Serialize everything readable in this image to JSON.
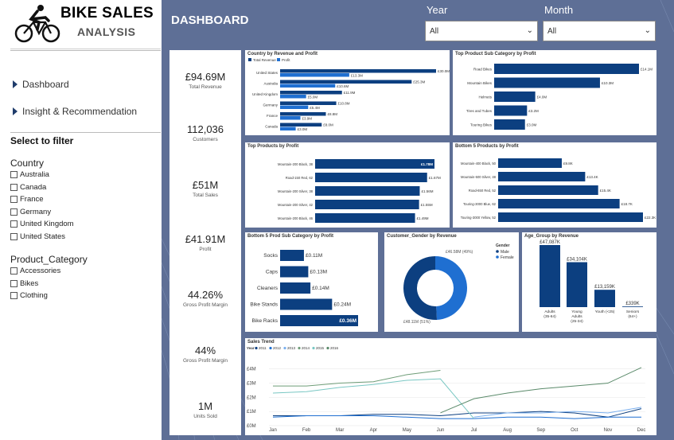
{
  "logo": {
    "title": "BIKE SALES",
    "subtitle": "ANALYSIS",
    "icon": "cyclist-icon"
  },
  "nav": [
    {
      "label": "Dashboard",
      "icon": "chevron-right-icon"
    },
    {
      "label": "Insight & Recommendation",
      "icon": "chevron-right-icon"
    }
  ],
  "filters": {
    "heading": "Select to filter",
    "country": {
      "title": "Country",
      "options": [
        "Australia",
        "Canada",
        "France",
        "Germany",
        "United Kingdom",
        "United States"
      ]
    },
    "category": {
      "title": "Product_Category",
      "options": [
        "Accessories",
        "Bikes",
        "Clothing"
      ]
    }
  },
  "header": {
    "title": "DASHBOARD"
  },
  "slicers": {
    "year": {
      "label": "Year",
      "value": "All"
    },
    "month": {
      "label": "Month",
      "value": "All"
    }
  },
  "kpis": [
    {
      "value": "£94.69M",
      "label": "Total Revenue"
    },
    {
      "value": "112,036",
      "label": "Customers"
    },
    {
      "value": "£51M",
      "label": "Total Sales"
    },
    {
      "value": "£41.91M",
      "label": "Profit"
    },
    {
      "value": "44.26%",
      "label": "Gross Profit Margin"
    },
    {
      "value": "44%",
      "label": "Gross Profit Margin"
    },
    {
      "value": "1M",
      "label": "Units Sold"
    }
  ],
  "colors": {
    "dark": "#0c3f80",
    "mid": "#1f6fd1",
    "light": "#7bb0ef",
    "accent": "#5e6f96"
  },
  "chart_data": [
    {
      "id": "country",
      "type": "bar",
      "title": "Country by Revenue and Profit",
      "legend": [
        "Total Revenue",
        "Profit"
      ],
      "categories": [
        "United States",
        "Australia",
        "United Kingdom",
        "Germany",
        "France",
        "Canada"
      ],
      "series": [
        {
          "name": "Total Revenue",
          "values": [
            30.0,
            25.3,
            11.9,
            10.8,
            8.8,
            8.0
          ],
          "labels": [
            "£30.0M",
            "£25.3M",
            "£11.9M",
            "£10.8M",
            "£8.8M",
            "£8.0M"
          ]
        },
        {
          "name": "Profit",
          "values": [
            13.3,
            10.6,
            5.0,
            5.4,
            3.9,
            3.0
          ],
          "labels": [
            "£13.3M",
            "£10.6M",
            "£5.0M",
            "£5.4M",
            "£3.9M",
            "£3.0M"
          ]
        }
      ]
    },
    {
      "id": "topsub",
      "type": "bar",
      "title": "Top Product Sub Category by Profit",
      "categories": [
        "Road Bikes",
        "Mountain Bikes",
        "Helmets",
        "Tires and Tubes",
        "Touring Bikes"
      ],
      "values": [
        14.1,
        10.3,
        4.0,
        3.2,
        3.0
      ],
      "labels": [
        "£14.1M",
        "£10.3M",
        "£4.0M",
        "£3.2M",
        "£3.0M"
      ]
    },
    {
      "id": "topprod",
      "type": "bar",
      "title": "Top Products by Profit",
      "categories": [
        "Mountain-200 Black, 38",
        "Road-150 Red, 62",
        "Mountain-200 Silver, 38",
        "Mountain-200 Silver, 42",
        "Mountain-200 Black, 46"
      ],
      "values": [
        1.78,
        1.67,
        1.56,
        1.55,
        1.49
      ],
      "labels": [
        "£1.78M",
        "£1.67M",
        "£1.56M",
        "£1.55M",
        "£1.49M"
      ]
    },
    {
      "id": "bottomprod",
      "type": "bar",
      "title": "Bottom 5 Products by Profit",
      "categories": [
        "Mountain-400 Black, 50",
        "Mountain-500 Silver, 48",
        "Road-650 Red, 52",
        "Touring-3000 Blue, 62",
        "Touring-3000 Yellow, 52"
      ],
      "values": [
        9.8,
        13.4,
        15.4,
        18.7,
        22.3
      ],
      "labels": [
        "£9.8K",
        "£13.4K",
        "£15.4K",
        "£18.7K",
        "£22.3K"
      ]
    },
    {
      "id": "bottomsub",
      "type": "bar",
      "title": "Bottom 5 Prod Sub Category by Profit",
      "categories": [
        "Socks",
        "Caps",
        "Cleaners",
        "Bike Stands",
        "Bike Racks"
      ],
      "values": [
        0.11,
        0.13,
        0.14,
        0.24,
        0.36
      ],
      "labels": [
        "£0.11M",
        "£0.13M",
        "£0.14M",
        "£0.24M",
        "£0.36M"
      ]
    },
    {
      "id": "gender",
      "type": "pie",
      "title": "Customer_Gender by Revenue",
      "legend_title": "Gender",
      "categories": [
        "Male",
        "Female"
      ],
      "values": [
        48.11,
        46.58
      ],
      "labels": [
        "£48.11M (51%)",
        "£46.58M (49%)"
      ]
    },
    {
      "id": "age",
      "type": "bar",
      "title": "Age_Group by Revenue",
      "categories": [
        "Adults (35-64)",
        "Young Adults (25-34)",
        "Youth (<25)",
        "Seniors (64+)"
      ],
      "category_lines": [
        [
          "Adults",
          "(35-64)"
        ],
        [
          "Young",
          "Adults",
          "(25-34)"
        ],
        [
          "Youth (<25)"
        ],
        [
          "Seniors",
          "(64+)"
        ]
      ],
      "values": [
        47.087,
        34.104,
        13.159,
        0.339
      ],
      "labels": [
        "£47,087K",
        "£34,104K",
        "£13,159K",
        "£339K"
      ]
    },
    {
      "id": "trend",
      "type": "line",
      "title": "Sales Trend",
      "legend_title": "Year",
      "x": [
        "Jan",
        "Feb",
        "Mar",
        "Apr",
        "May",
        "Jun",
        "Jul",
        "Aug",
        "Sep",
        "Oct",
        "Nov",
        "Dec"
      ],
      "yticks": [
        "£0M",
        "£1M",
        "£2M",
        "£3M",
        "£4M"
      ],
      "ylim": [
        0,
        4.6
      ],
      "series": [
        {
          "name": "2011",
          "color": "#0c3f80",
          "values": [
            0.7,
            0.7,
            0.7,
            0.8,
            0.8,
            0.7,
            0.9,
            0.9,
            1.0,
            0.9,
            0.6,
            1.2
          ]
        },
        {
          "name": "2012",
          "color": "#1f6fd1",
          "values": [
            0.6,
            0.7,
            0.7,
            0.7,
            0.6,
            0.5,
            0.5,
            0.6,
            0.6,
            0.5,
            0.6,
            0.6
          ]
        },
        {
          "name": "2013",
          "color": "#7bb0ef",
          "values": [
            null,
            null,
            null,
            null,
            null,
            null,
            0.6,
            0.9,
            0.9,
            1.0,
            0.9,
            1.3
          ]
        },
        {
          "name": "2014",
          "color": "#6f9d78",
          "values": [
            2.8,
            2.8,
            3.0,
            3.1,
            3.6,
            3.9,
            null,
            null,
            null,
            null,
            null,
            null
          ]
        },
        {
          "name": "2015",
          "color": "#79c7c3",
          "values": [
            2.3,
            2.4,
            2.7,
            2.9,
            3.2,
            3.3,
            0.5,
            null,
            null,
            null,
            null,
            null
          ]
        },
        {
          "name": "2016",
          "color": "#5a8a6a",
          "values": [
            null,
            null,
            null,
            null,
            null,
            0.9,
            1.9,
            2.3,
            2.6,
            2.8,
            3.0,
            4.1
          ]
        }
      ]
    }
  ]
}
